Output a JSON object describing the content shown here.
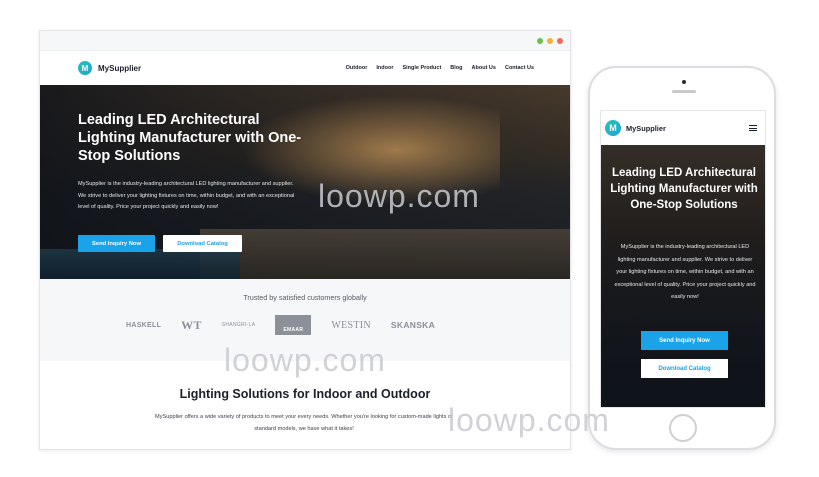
{
  "site": {
    "brand_letter": "M",
    "brand_name": "MySupplier",
    "menu": [
      "Outdoor",
      "Indoor",
      "Single Product",
      "Blog",
      "About Us",
      "Contact Us"
    ]
  },
  "hero": {
    "title": "Leading LED Architectural Lighting Manufacturer with One-Stop Solutions",
    "description": "MySupplier is the industry-leading architectural LED lighting manufacturer and supplier. We strive to deliver your lighting fixtures on time, within budget, and with an exceptional level of quality. Price your project quickly and easily now!",
    "primary_button": "Send Inquiry Now",
    "secondary_button": "Download Catalog"
  },
  "trusted": {
    "title": "Trusted by satisfied customers globally",
    "logos": [
      "HASKELL",
      "WT",
      "SHANGRI-LA",
      "EMAAR",
      "WESTIN",
      "SKANSKA"
    ]
  },
  "solutions": {
    "title": "Lighting Solutions for Indoor and Outdoor",
    "description": "MySupplier offers a wide variety of products to meet your every needs. Whether you're looking for custom-made lights or standard models, we have what it takes!"
  },
  "watermark": "loowp.com",
  "colors": {
    "accent": "#1aa3e8",
    "brand_gradient_start": "#27c4b4",
    "brand_gradient_end": "#1fa3d8"
  }
}
